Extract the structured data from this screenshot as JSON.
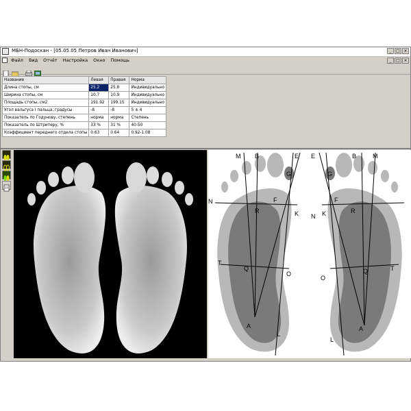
{
  "window": {
    "title": "МБН-Подоскан - [05.05.05 Петров Иван Иванович]",
    "controls": [
      "_",
      "□",
      "×"
    ]
  },
  "menu": {
    "items": [
      "Файл",
      "Вид",
      "Отчёт",
      "Настройка",
      "Окно",
      "Помощь"
    ],
    "controls": [
      "_",
      "□",
      "×"
    ]
  },
  "toolbar": {
    "buttons": [
      "new-document",
      "open-folder",
      "print",
      "export"
    ]
  },
  "table": {
    "headers": [
      "Название",
      "Левая",
      "Правая",
      "Норма"
    ],
    "rows": [
      [
        "Длина стопы, см",
        "25.2",
        "25.8",
        "Индивидуально"
      ],
      [
        "Ширина стопы, см",
        "10.7",
        "10.9",
        "Индивидуально"
      ],
      [
        "Площадь стопы, см2",
        "191.92",
        "199.15",
        "Индивидуально"
      ],
      [
        "Угол вальгуса I пальца, градусы",
        "-8",
        "-8",
        "5 ± 4"
      ],
      [
        "Показатель по Годунову, степень",
        "норма",
        "норма",
        "Степень"
      ],
      [
        "Показатель по Штритеру, %",
        "33 %",
        "31 %",
        "40-50"
      ],
      [
        "Коэффициент переднего отдела стопы",
        "0.63",
        "0.64",
        "0.92-1.08"
      ]
    ]
  },
  "side_tools": [
    "feet-icon",
    "feet-outline-icon",
    "feet-color-icon",
    "report-icon"
  ],
  "analysis": {
    "left_points": [
      "M",
      "B",
      "E",
      "G",
      "N",
      "F",
      "R",
      "K",
      "T",
      "Q",
      "O",
      "A",
      "L"
    ],
    "right_points": [
      "E",
      "B",
      "M",
      "G",
      "F",
      "R",
      "K",
      "N",
      "O",
      "Q",
      "T",
      "L",
      "A"
    ]
  }
}
